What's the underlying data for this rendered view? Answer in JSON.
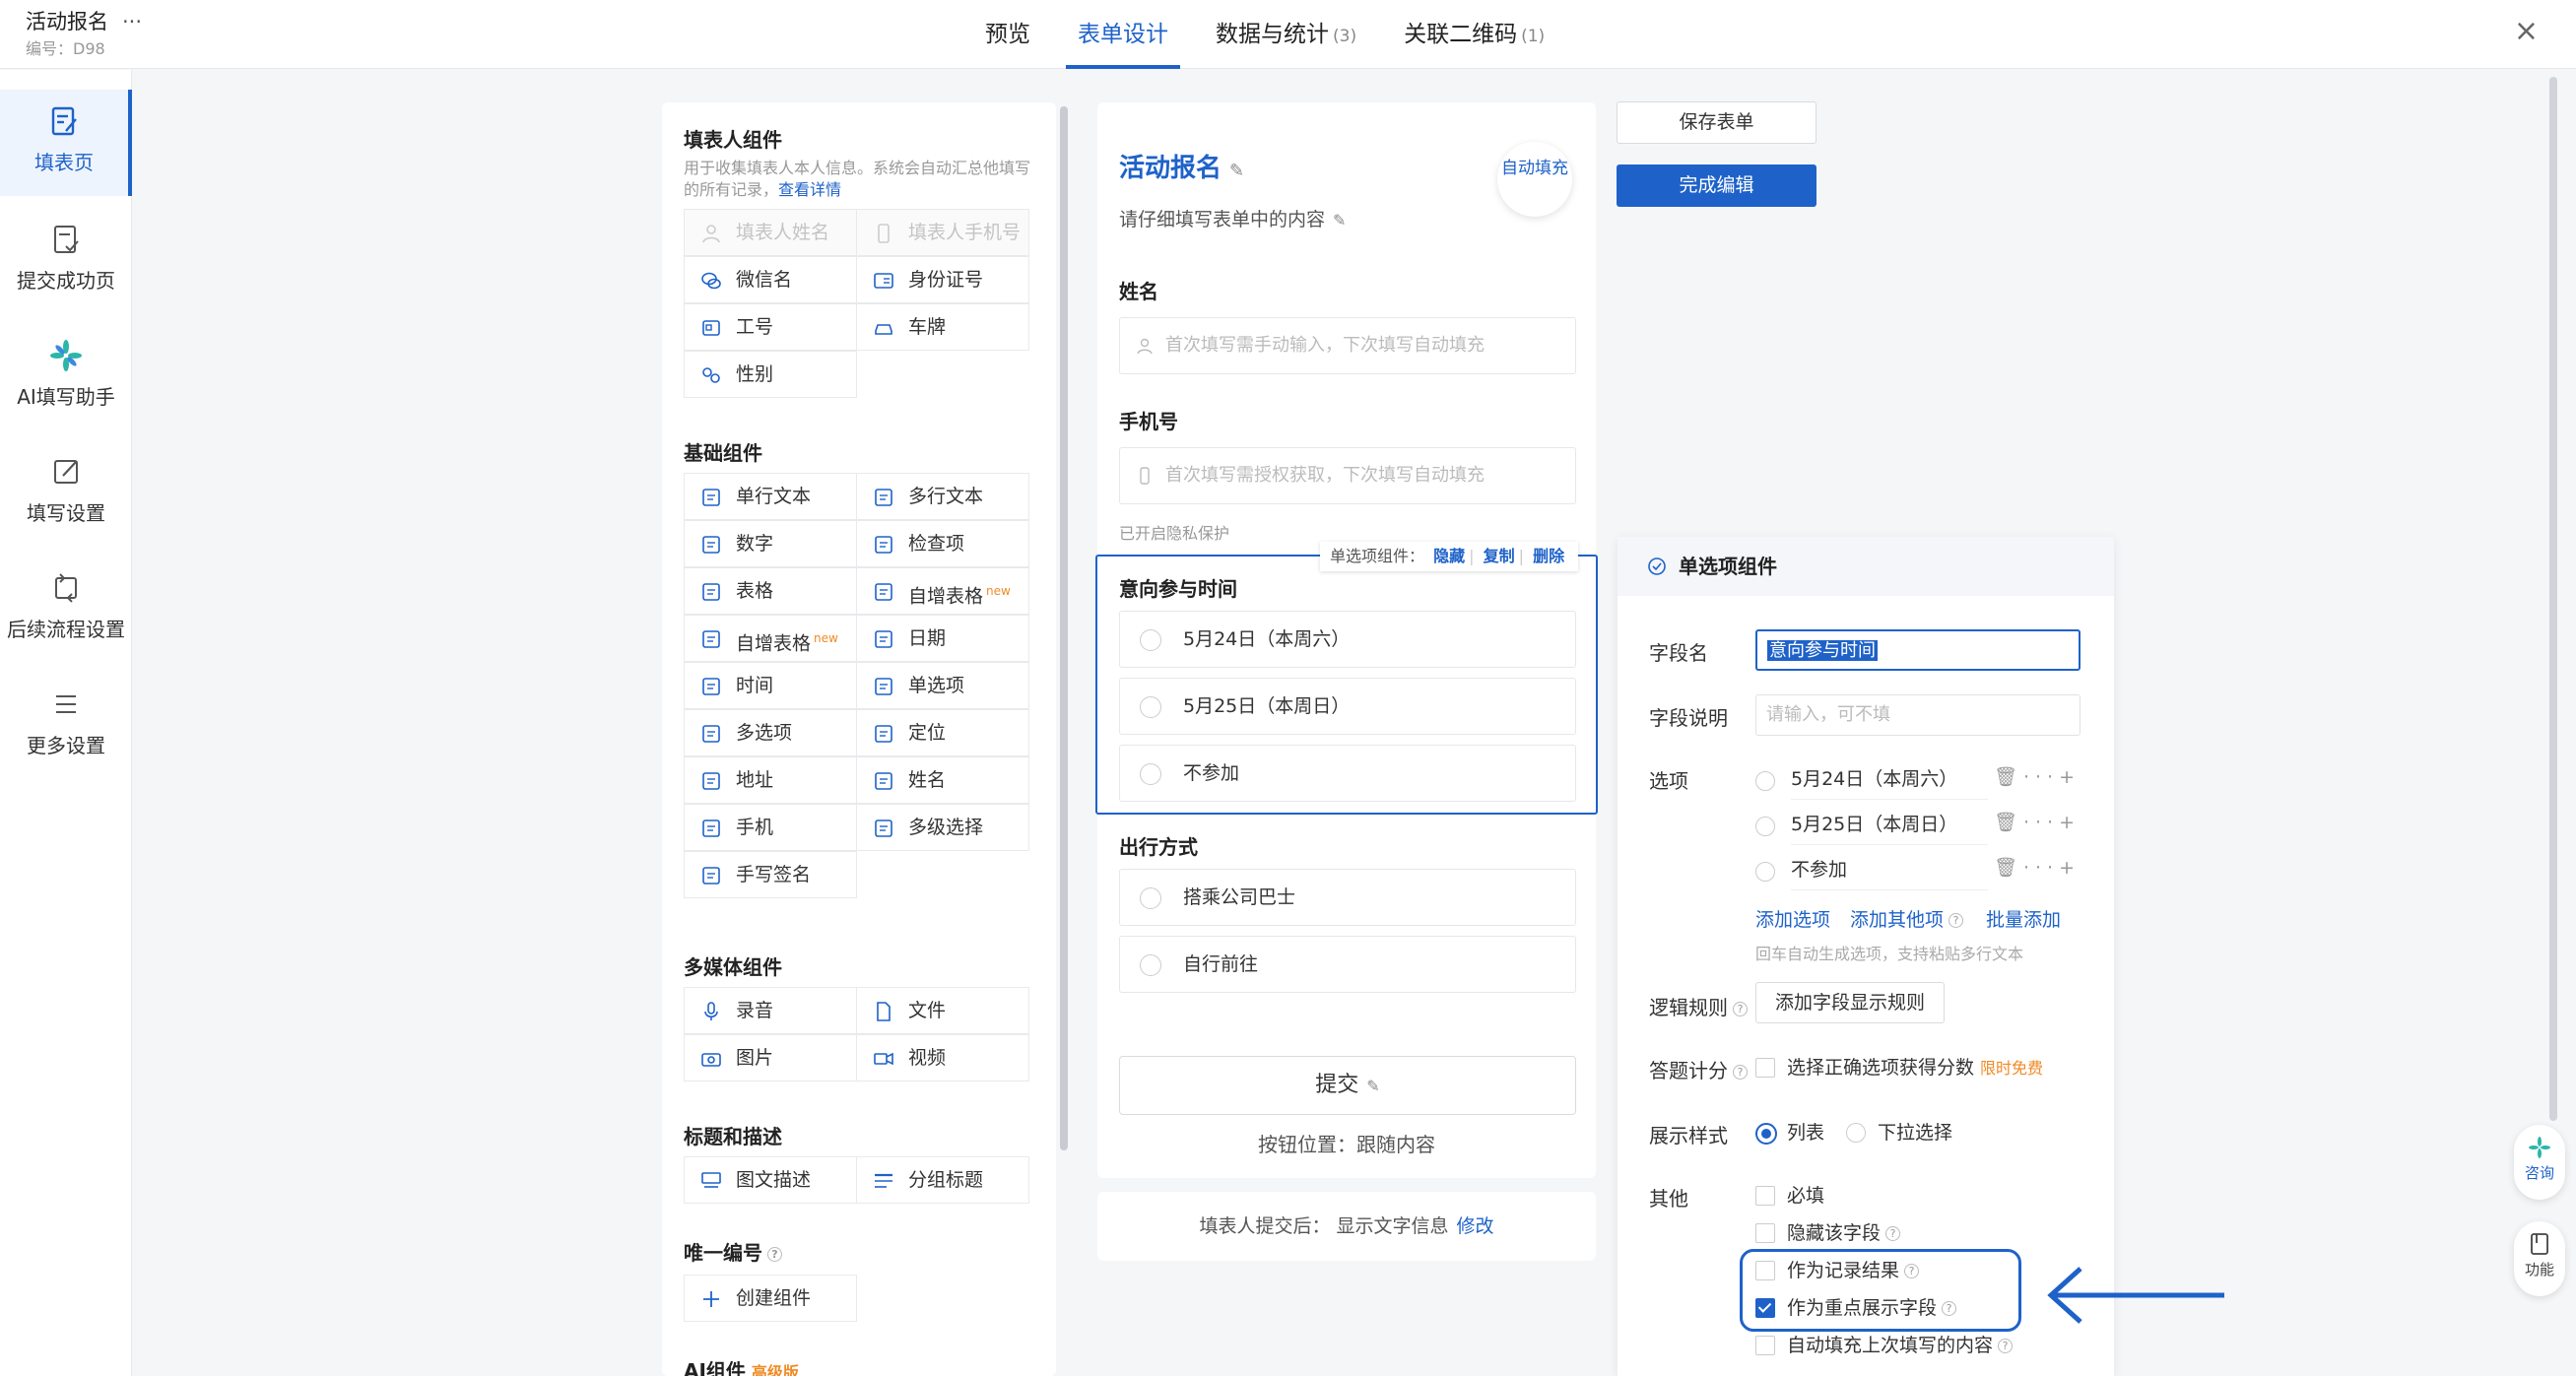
{
  "app": {
    "title": "活动报名",
    "more": "···",
    "code": "编号：D98",
    "close": "×"
  },
  "tabs": [
    {
      "label": "预览",
      "count": ""
    },
    {
      "label": "表单设计",
      "count": ""
    },
    {
      "label": "数据与统计",
      "count": "(3)"
    },
    {
      "label": "关联二维码",
      "count": "(1)"
    }
  ],
  "sidebar": [
    {
      "label": "填表页",
      "icon": "form-edit-icon"
    },
    {
      "label": "提交成功页",
      "icon": "submit-success-icon"
    },
    {
      "label": "AI填写助手",
      "icon": "ai-assistant-icon"
    },
    {
      "label": "填写设置",
      "icon": "fill-settings-icon"
    },
    {
      "label": "后续流程设置",
      "icon": "workflow-icon"
    },
    {
      "label": "更多设置",
      "icon": "menu-icon"
    }
  ],
  "components": {
    "filler_title": "填表人组件",
    "filler_desc": "用于收集填表人本人信息。系统会自动汇总他填写的所有记录，",
    "filler_desc_link": "查看详情",
    "filler": [
      "填表人姓名",
      "填表人手机号",
      "微信名",
      "身份证号",
      "工号",
      "车牌",
      "性别"
    ],
    "basic_title": "基础组件",
    "basic": [
      "单行文本",
      "多行文本",
      "数字",
      "检查项",
      "表格",
      "自增表格",
      "自增表格",
      "日期",
      "时间",
      "单选项",
      "多选项",
      "定位",
      "地址",
      "姓名",
      "手机",
      "多级选择",
      "手写签名"
    ],
    "new_badge": "new",
    "media_title": "多媒体组件",
    "media": [
      "录音",
      "文件",
      "图片",
      "视频"
    ],
    "heading_title": "标题和描述",
    "heading": [
      "图文描述",
      "分组标题"
    ],
    "unique_title": "唯一编号",
    "unique": [
      "创建组件"
    ],
    "ai_title": "AI组件",
    "ai_badge": "高级版"
  },
  "form": {
    "title": "活动报名",
    "subtitle": "请仔细填写表单中的内容",
    "auto_fill": "自动填充",
    "name_label": "姓名",
    "name_placeholder": "首次填写需手动输入，下次填写自动填充",
    "phone_label": "手机号",
    "phone_placeholder": "首次填写需授权获取，下次填写自动填充",
    "privacy_note": "已开启隐私保护",
    "field1_label": "意向参与时间",
    "field1_options": [
      "5月24日（本周六）",
      "5月25日（本周日）",
      "不参加"
    ],
    "field2_label": "出行方式",
    "field2_options": [
      "搭乘公司巴士",
      "自行前往"
    ],
    "submit": "提交",
    "submit_pos": "按钮位置：跟随内容",
    "after_submit": "填表人提交后： 显示文字信息",
    "after_submit_link": "修改"
  },
  "selection_toolbar": {
    "label": "单选项组件：",
    "hide": "隐藏",
    "copy": "复制",
    "delete": "删除",
    "sep": "|"
  },
  "actions": {
    "save": "保存表单",
    "done": "完成编辑"
  },
  "props": {
    "header": "单选项组件",
    "field_name_label": "字段名",
    "field_name_value": "意向参与时间",
    "field_desc_label": "字段说明",
    "field_desc_placeholder": "请输入，可不填",
    "options_label": "选项",
    "options": [
      "5月24日（本周六）",
      "5月25日（本周日）",
      "不参加"
    ],
    "add_option": "添加选项",
    "add_other": "添加其他项",
    "batch_add": "批量添加",
    "options_hint": "回车自动生成选项，支持粘贴多行文本",
    "logic_label": "逻辑规则",
    "logic_button": "添加字段显示规则",
    "score_label": "答题计分",
    "score_option": "选择正确选项获得分数",
    "score_badge": "限时免费",
    "style_label": "展示样式",
    "style_list": "列表",
    "style_dropdown": "下拉选择",
    "other_label": "其他",
    "other_options": [
      "必填",
      "隐藏该字段",
      "作为记录结果",
      "作为重点展示字段",
      "自动填充上次填写的内容"
    ]
  },
  "float": {
    "consult": "咨询",
    "features": "功能"
  },
  "colors": {
    "accent": "#1e62c9",
    "badge": "#f08a24"
  }
}
